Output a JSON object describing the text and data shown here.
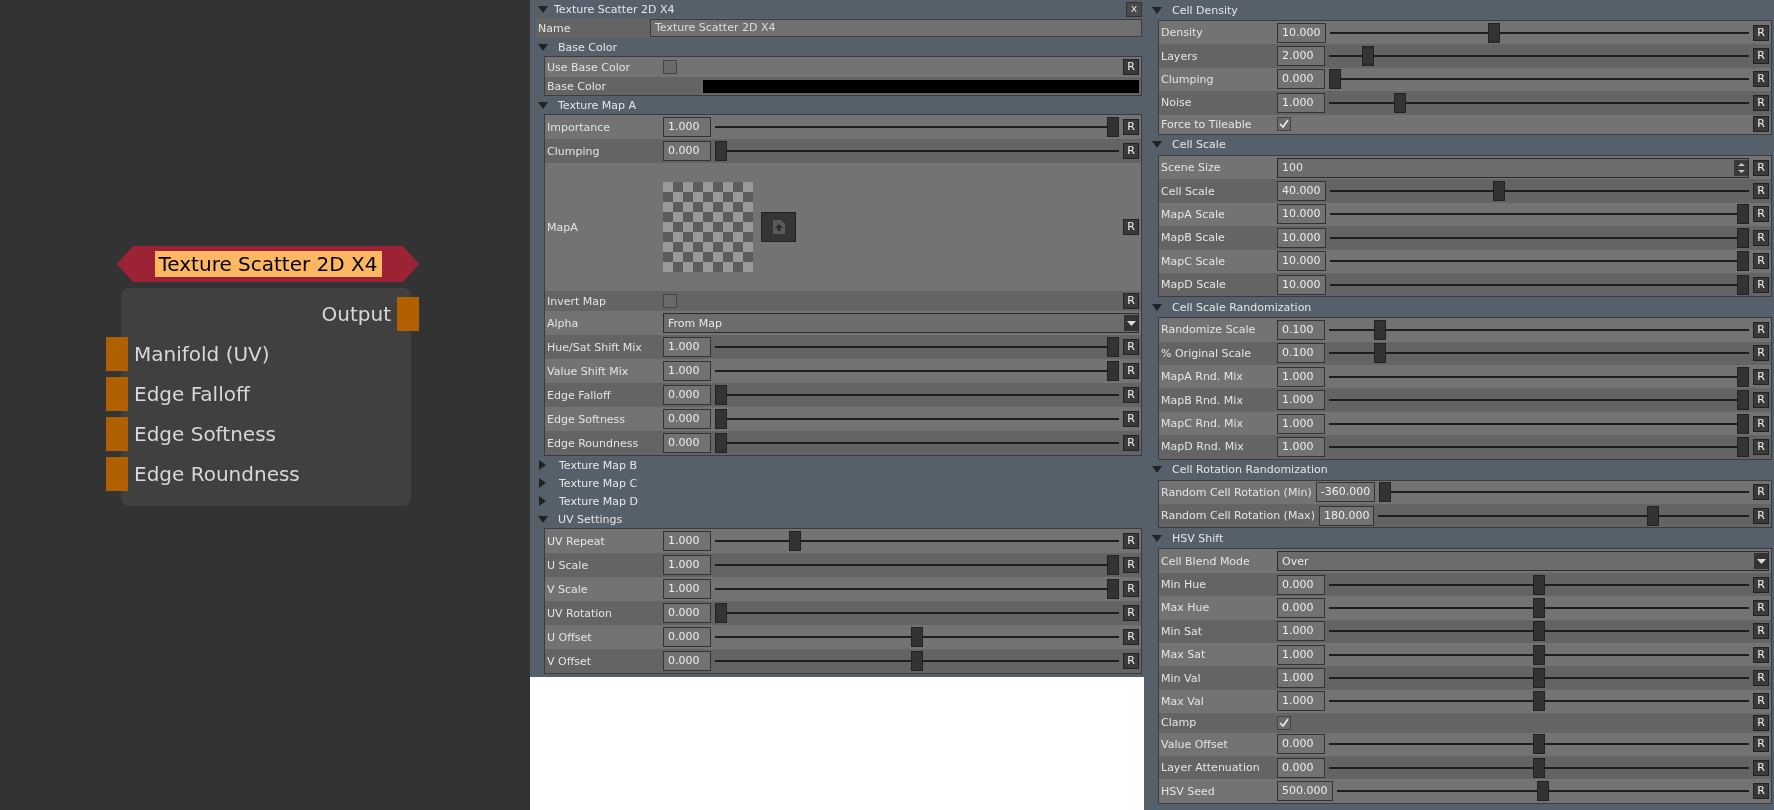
{
  "node": {
    "title": "Texture Scatter 2D X4",
    "output": "Output",
    "inputs": [
      "Manifold (UV)",
      "Edge Falloff",
      "Edge Softness",
      "Edge Roundness"
    ]
  },
  "editor": {
    "title": "Texture Scatter 2D X4",
    "close": "x",
    "name": {
      "label": "Name",
      "value": "Texture Scatter 2D X4"
    },
    "sections": [
      {
        "title": "Base Color",
        "expanded": true,
        "rows": [
          {
            "kind": "checkbox",
            "label": "Use Base Color",
            "checked": false,
            "reset": "R"
          },
          {
            "kind": "color",
            "label": "Base Color",
            "color": "#000000"
          }
        ]
      },
      {
        "title": "Texture Map A",
        "expanded": true,
        "rows": [
          {
            "kind": "slider",
            "label": "Importance",
            "value": "1.000",
            "level": 1,
            "reset": "R"
          },
          {
            "kind": "slider",
            "label": "Clumping",
            "value": "0.000",
            "level": 0,
            "reset": "R"
          },
          {
            "kind": "map",
            "label": "MapA",
            "reset": "R"
          },
          {
            "kind": "checkbox",
            "label": "Invert Map",
            "checked": false,
            "reset": "R"
          },
          {
            "kind": "dropdown",
            "label": "Alpha",
            "value": "From Map"
          },
          {
            "kind": "slider",
            "label": "Hue/Sat Shift Mix",
            "value": "1.000",
            "level": 1,
            "reset": "R"
          },
          {
            "kind": "slider",
            "label": "Value Shift Mix",
            "value": "1.000",
            "level": 1,
            "reset": "R"
          },
          {
            "kind": "slider",
            "label": "Edge Falloff",
            "value": "0.000",
            "level": 0,
            "reset": "R"
          },
          {
            "kind": "slider",
            "label": "Edge Softness",
            "value": "0.000",
            "level": 0,
            "reset": "R"
          },
          {
            "kind": "slider",
            "label": "Edge Roundness",
            "value": "0.000",
            "level": 0,
            "reset": "R"
          }
        ]
      },
      {
        "title": "Texture Map B",
        "expanded": false
      },
      {
        "title": "Texture Map C",
        "expanded": false
      },
      {
        "title": "Texture Map D",
        "expanded": false
      },
      {
        "title": "UV Settings",
        "expanded": true,
        "rows": [
          {
            "kind": "slider",
            "label": "UV Repeat",
            "value": "1.000",
            "level": 0.19,
            "reset": "R"
          },
          {
            "kind": "slider",
            "label": "U Scale",
            "value": "1.000",
            "level": 1,
            "reset": "R"
          },
          {
            "kind": "slider",
            "label": "V Scale",
            "value": "1.000",
            "level": 1,
            "reset": "R"
          },
          {
            "kind": "slider",
            "label": "UV Rotation",
            "value": "0.000",
            "level": 0,
            "reset": "R"
          },
          {
            "kind": "slider",
            "label": "U Offset",
            "value": "0.000",
            "level": 0.5,
            "reset": "R"
          },
          {
            "kind": "slider",
            "label": "V Offset",
            "value": "0.000",
            "level": 0.5,
            "reset": "R"
          }
        ]
      }
    ]
  },
  "inspector": {
    "sections": [
      {
        "title": "Cell Density",
        "expanded": true,
        "rows": [
          {
            "kind": "slider",
            "label": "Density",
            "value": "10.000",
            "level": 0.39,
            "reset": "R"
          },
          {
            "kind": "slider",
            "label": "Layers",
            "value": "2.000",
            "level": 0.08,
            "reset": "R"
          },
          {
            "kind": "slider",
            "label": "Clumping",
            "value": "0.000",
            "level": 0,
            "reset": "R"
          },
          {
            "kind": "slider",
            "label": "Noise",
            "value": "1.000",
            "level": 0.16,
            "reset": "R"
          },
          {
            "kind": "checkbox",
            "label": "Force to Tileable",
            "checked": true,
            "reset": "R"
          }
        ]
      },
      {
        "title": "Cell Scale",
        "expanded": true,
        "rows": [
          {
            "kind": "spinbox",
            "label": "Scene Size",
            "value": "100",
            "reset": "R"
          },
          {
            "kind": "slider",
            "label": "Cell Scale",
            "value": "40.000",
            "level": 0.4,
            "reset": "R"
          },
          {
            "kind": "slider",
            "label": "MapA Scale",
            "value": "10.000",
            "level": 1,
            "reset": "R"
          },
          {
            "kind": "slider",
            "label": "MapB Scale",
            "value": "10.000",
            "level": 1,
            "reset": "R"
          },
          {
            "kind": "slider",
            "label": "MapC Scale",
            "value": "10.000",
            "level": 1,
            "reset": "R"
          },
          {
            "kind": "slider",
            "label": "MapD Scale",
            "value": "10.000",
            "level": 1,
            "reset": "R"
          }
        ]
      },
      {
        "title": "Cell Scale Randomization",
        "expanded": true,
        "rows": [
          {
            "kind": "slider",
            "label": "Randomize Scale",
            "value": "0.100",
            "level": 0.11,
            "reset": "R"
          },
          {
            "kind": "slider",
            "label": "% Original Scale",
            "value": "0.100",
            "level": 0.11,
            "reset": "R"
          },
          {
            "kind": "slider",
            "label": "MapA Rnd. Mix",
            "value": "1.000",
            "level": 1,
            "reset": "R"
          },
          {
            "kind": "slider",
            "label": "MapB Rnd. Mix",
            "value": "1.000",
            "level": 1,
            "reset": "R"
          },
          {
            "kind": "slider",
            "label": "MapC Rnd. Mix",
            "value": "1.000",
            "level": 1,
            "reset": "R"
          },
          {
            "kind": "slider",
            "label": "MapD Rnd. Mix",
            "value": "1.000",
            "level": 1,
            "reset": "R"
          }
        ]
      },
      {
        "title": "Cell Rotation Randomization",
        "expanded": true,
        "rows": [
          {
            "kind": "slider",
            "label": "Random Cell Rotation (Min)",
            "value": "-360.000",
            "level": 0,
            "reset": "R"
          },
          {
            "kind": "slider",
            "label": "Random Cell Rotation (Max)",
            "value": "180.000",
            "level": 0.75,
            "reset": "R"
          }
        ]
      },
      {
        "title": "HSV Shift",
        "expanded": true,
        "rows": [
          {
            "kind": "dropdown",
            "label": "Cell Blend Mode",
            "value": "Over"
          },
          {
            "kind": "slider",
            "label": "Min Hue",
            "value": "0.000",
            "level": 0.5,
            "reset": "R"
          },
          {
            "kind": "slider",
            "label": "Max Hue",
            "value": "0.000",
            "level": 0.5,
            "reset": "R"
          },
          {
            "kind": "slider",
            "label": "Min Sat",
            "value": "1.000",
            "level": 0.5,
            "reset": "R"
          },
          {
            "kind": "slider",
            "label": "Max Sat",
            "value": "1.000",
            "level": 0.5,
            "reset": "R"
          },
          {
            "kind": "slider",
            "label": "Min Val",
            "value": "1.000",
            "level": 0.5,
            "reset": "R"
          },
          {
            "kind": "slider",
            "label": "Max Val",
            "value": "1.000",
            "level": 0.5,
            "reset": "R"
          },
          {
            "kind": "checkbox",
            "label": "Clamp",
            "checked": true,
            "reset": "R"
          },
          {
            "kind": "slider",
            "label": "Value Offset",
            "value": "0.000",
            "level": 0.5,
            "reset": "R"
          },
          {
            "kind": "slider",
            "label": "Layer Attenuation",
            "value": "0.000",
            "level": 0.5,
            "reset": "R"
          },
          {
            "kind": "slider",
            "label": "HSV Seed",
            "value": "500.000",
            "level": 0.5,
            "reset": "R"
          }
        ]
      }
    ]
  }
}
